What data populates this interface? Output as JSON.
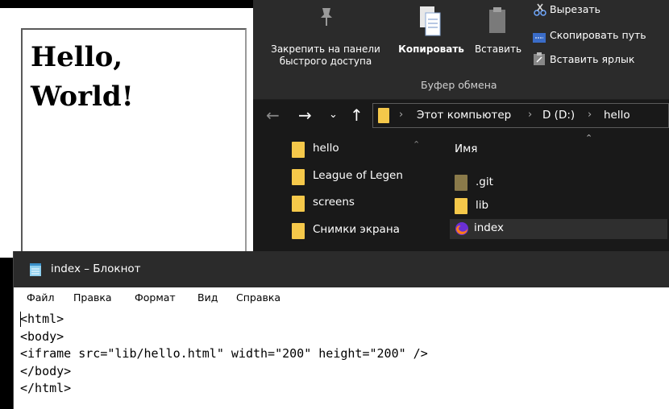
{
  "preview": {
    "heading": "Hello, World!"
  },
  "explorer": {
    "ribbon": {
      "pin_label": "Закрепить на панели быстрого доступа",
      "copy_label": "Копировать",
      "paste_label": "Вставить",
      "cut_label": "Вырезать",
      "copy_path_label": "Скопировать путь",
      "paste_shortcut_label": "Вставить ярлык",
      "group_label": "Буфер обмена"
    },
    "breadcrumb": [
      "Этот компьютер",
      "D (D:)",
      "hello"
    ],
    "nav_pane": [
      {
        "label": "hello",
        "icon": "folder-icon"
      },
      {
        "label": "League of Legen",
        "icon": "folder-icon"
      },
      {
        "label": "screens",
        "icon": "folder-icon"
      },
      {
        "label": "Снимки экрана",
        "icon": "folder-icon"
      }
    ],
    "column_header": "Имя",
    "files": [
      {
        "label": ".git",
        "icon": "folder-icon"
      },
      {
        "label": "lib",
        "icon": "folder-icon"
      },
      {
        "label": "index",
        "icon": "firefox-icon"
      }
    ]
  },
  "notepad": {
    "title": "index – Блокнот",
    "menu": [
      "Файл",
      "Правка",
      "Формат",
      "Вид",
      "Справка"
    ],
    "content": "<html>\n<body>\n<iframe src=\"lib/hello.html\" width=\"200\" height=\"200\" />\n</body>\n</html>"
  },
  "colors": {
    "folder": "#f5c84a",
    "dark_bg": "#191919",
    "ribbon_bg": "#2b2b2b"
  }
}
